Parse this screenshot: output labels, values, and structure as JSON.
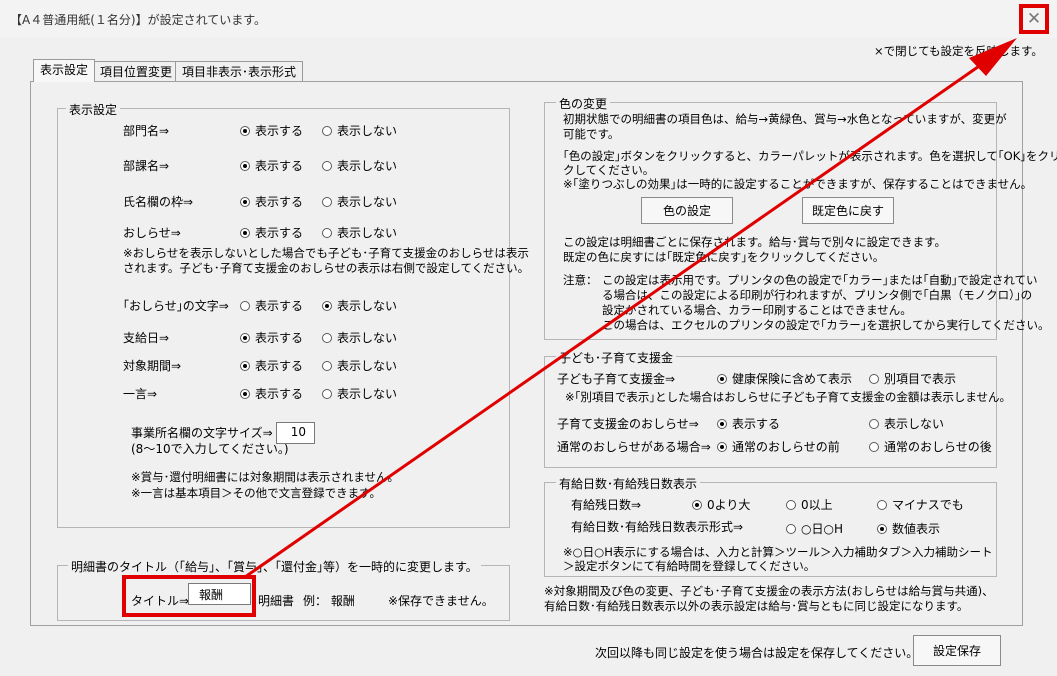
{
  "window": {
    "title": "【A４普通用紙(１名分)】が設定されています。",
    "close_glyph": "✕"
  },
  "top_note": "×で閉じても設定を反映します。",
  "tabs": [
    "表示設定",
    "項目位置変更",
    "項目非表示･表示形式"
  ],
  "display": {
    "legend": "表示設定",
    "rows": [
      {
        "label": "部門名⇒",
        "opt1": "表示する",
        "opt2": "表示しない",
        "selected": 1
      },
      {
        "label": "部課名⇒",
        "opt1": "表示する",
        "opt2": "表示しない",
        "selected": 1
      },
      {
        "label": "氏名欄の枠⇒",
        "opt1": "表示する",
        "opt2": "表示しない",
        "selected": 1
      },
      {
        "label": "おしらせ⇒",
        "opt1": "表示する",
        "opt2": "表示しない",
        "selected": 1
      },
      {
        "label": "｢おしらせ｣の文字⇒",
        "opt1": "表示する",
        "opt2": "表示しない",
        "selected": 2
      },
      {
        "label": "支給日⇒",
        "opt1": "表示する",
        "opt2": "表示しない",
        "selected": 1
      },
      {
        "label": "対象期間⇒",
        "opt1": "表示する",
        "opt2": "表示しない",
        "selected": 1
      },
      {
        "label": "一言⇒",
        "opt1": "表示する",
        "opt2": "表示しない",
        "selected": 1
      }
    ],
    "note1": "※おしらせを表示しないとした場合でも子ども･子育て支援金のおしらせは表示",
    "note2": "されます。子ども･子育て支援金のおしらせの表示は右側で設定してください。",
    "fontsize_label1": "事業所名欄の文字サイズ⇒",
    "fontsize_label2": "(8～10で入力してください。)",
    "fontsize_value": "10",
    "foot1": "※賞与･還付明細書には対象期間は表示されません。",
    "foot2": "※一言は基本項目＞その他で文言登録できます。"
  },
  "title_change": {
    "legend": "明細書のタイトル（｢給与｣、｢賞与｣、｢還付金｣等）を一時的に変更します。",
    "label": "タイトル⇒",
    "value": "報酬",
    "suffix": "明細書",
    "example": "例：  報酬",
    "note": "※保存できません。"
  },
  "color": {
    "legend": "色の変更",
    "p1a": "初期状態での明細書の項目色は、給与→黄緑色、賞与→水色となっていますが、変更が",
    "p1b": "可能です。",
    "p2a": "｢色の設定｣ボタンをクリックすると、カラーパレットが表示されます。色を選択して｢OK｣をクリッ",
    "p2b": "クしてください。",
    "p2c": "※｢塗りつぶしの効果｣は一時的に設定することができますが、保存することはできません。",
    "btn_set": "色の設定",
    "btn_reset": "既定色に戻す",
    "p3a": "この設定は明細書ごとに保存されます。給与･賞与で別々に設定できます。",
    "p3b": "既定の色に戻すには｢既定色に戻す｣をクリックしてください。",
    "caution_label": "注意：",
    "c1": "この設定は表示用です。プリンタの色の設定で｢カラー｣または｢自動｣で設定されてい",
    "c2": "る場合は、この設定による印刷が行われますが、プリンタ側で｢白黒（モノクロ）｣の",
    "c3": "設定がされている場合、カラー印刷することはできません。",
    "c4": "この場合は、エクセルのプリンタの設定で｢カラー｣を選択してから実行してください。"
  },
  "childcare": {
    "legend": "子ども･子育て支援金",
    "r1_label": "子ども子育て支援金⇒",
    "r1_opt1": "健康保険に含めて表示",
    "r1_opt2": "別項目で表示",
    "r1_note": "※｢別項目で表示｣とした場合はおしらせに子ども子育て支援金の金額は表示しません。",
    "r2_label": "子育て支援金のおしらせ⇒",
    "r2_opt1": "表示する",
    "r2_opt2": "表示しない",
    "r3_label": "通常のおしらせがある場合⇒",
    "r3_opt1": "通常のおしらせの前",
    "r3_opt2": "通常のおしらせの後"
  },
  "paid_leave": {
    "legend": "有給日数･有給残日数表示",
    "r1_label": "有給残日数⇒",
    "r1_opt1": "0より大",
    "r1_opt2": "0以上",
    "r1_opt3": "マイナスでも",
    "r2_label": "有給日数･有給残日数表示形式⇒",
    "r2_opt1": "○日○H",
    "r2_opt2": "数値表示",
    "note1": "※○日○H表示にする場合は、入力と計算＞ツール＞入力補助タブ＞入力補助シート",
    "note2": "＞設定ボタンにて有給時間を登録してください。"
  },
  "bottom_note1": "※対象期間及び色の変更、子ども･子育て支援金の表示方法(おしらせは給与賞与共通)、",
  "bottom_note2": "有給日数･有給残日数表示以外の表示設定は給与･賞与ともに同じ設定になります。",
  "footer_text": "次回以降も同じ設定を使う場合は設定を保存してください。⇒",
  "save_button": "設定保存",
  "accent_color": "#e00000"
}
